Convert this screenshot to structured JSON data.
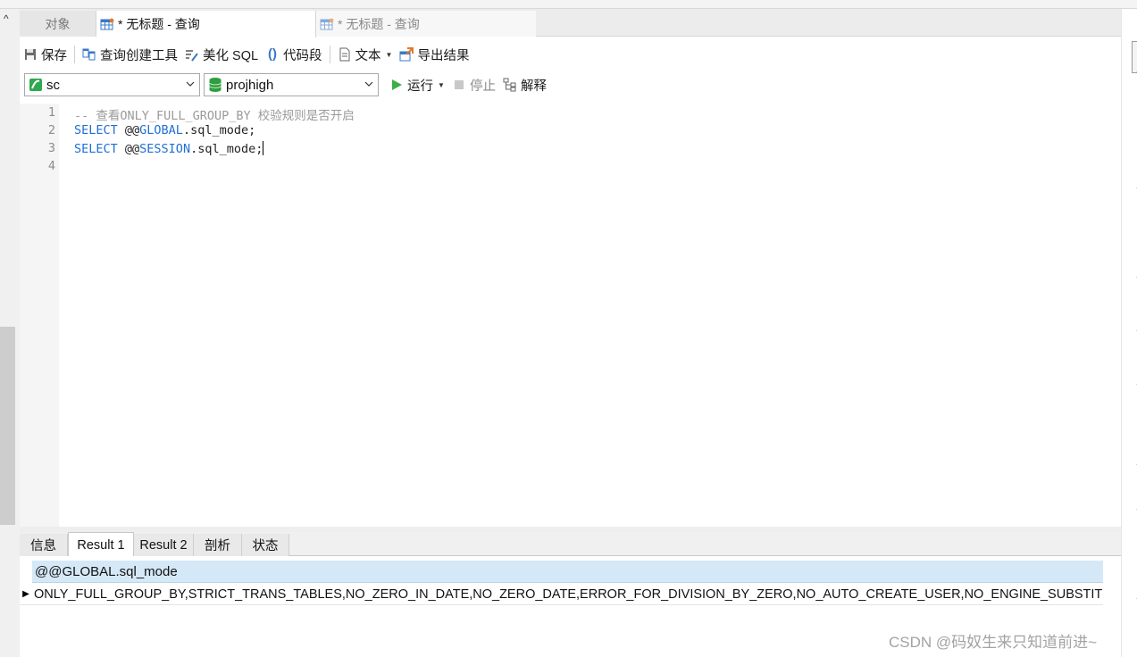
{
  "tabs": {
    "objects": "对象",
    "query_1": "* 无标题 - 查询",
    "query_2": "* 无标题 - 查询"
  },
  "toolbar": {
    "save": "保存",
    "query_builder": "查询创建工具",
    "beautify_sql": "美化 SQL",
    "snippets": "代码段",
    "text": "文本",
    "export_results": "导出结果"
  },
  "query_bar": {
    "connection": "sc",
    "database": "projhigh",
    "run": "运行",
    "stop": "停止",
    "explain": "解释"
  },
  "editor": {
    "line_numbers": [
      "1",
      "2",
      "3",
      "4"
    ],
    "comment": "-- 查看ONLY_FULL_GROUP_BY 校验规则是否开启",
    "select_keyword": "SELECT",
    "line2_rest_a": " @@",
    "line2_var": "GLOBAL",
    "line2_rest_b": ".sql_mode;",
    "line3_rest_a": " @@",
    "line3_var": "SESSION",
    "line3_rest_b": ".sql_mode;"
  },
  "result_tabs": [
    "信息",
    "Result 1",
    "Result 2",
    "剖析",
    "状态"
  ],
  "result_grid": {
    "column": "@@GLOBAL.sql_mode",
    "value": "ONLY_FULL_GROUP_BY,STRICT_TRANS_TABLES,NO_ZERO_IN_DATE,NO_ZERO_DATE,ERROR_FOR_DIVISION_BY_ZERO,NO_AUTO_CREATE_USER,NO_ENGINE_SUBSTITUTION"
  },
  "watermark": "CSDN @码奴生来只知道前进~",
  "colors": {
    "keyword": "#1f6fd6",
    "comment": "#9a9a9a",
    "grid_header": "#d5e8f7",
    "run_icon": "#3cb043",
    "db_icon": "#2e9e3e"
  }
}
